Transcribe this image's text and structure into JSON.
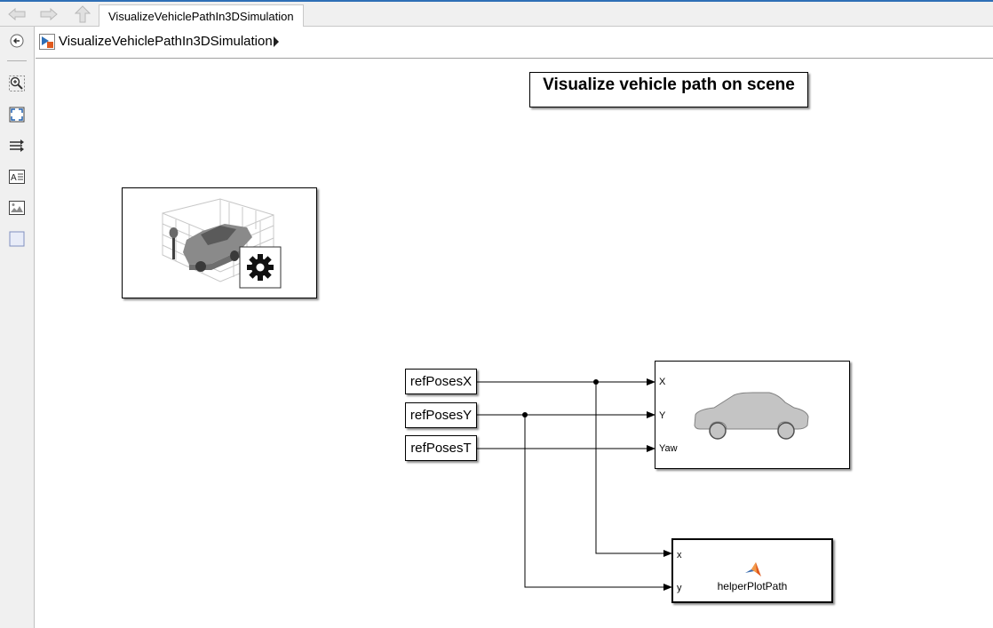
{
  "tab": {
    "title": "VisualizeVehiclePathIn3DSimulation"
  },
  "breadcrumb": {
    "label": "VisualizeVehiclePathIn3DSimulation"
  },
  "nav": {
    "back": "back-arrow-icon",
    "forward": "forward-arrow-icon",
    "up": "up-arrow-icon"
  },
  "toolbar": [
    "hide-browser-icon",
    "zoom-in-icon",
    "fit-to-view-icon",
    "signal-routing-icon",
    "annotation-icon",
    "image-icon",
    "area-icon"
  ],
  "annotation": {
    "title": "Visualize vehicle path on scene"
  },
  "blocks": {
    "from_x": "refPosesX",
    "from_y": "refPosesY",
    "from_t": "refPosesT",
    "vehicle_ports": [
      "X",
      "Y",
      "Yaw"
    ],
    "plot_ports": [
      "x",
      "y"
    ],
    "plot_name": "helperPlotPath"
  },
  "colors": {
    "accent": "#2f6fb6",
    "block_border": "#000000",
    "canvas": "#ffffff"
  }
}
